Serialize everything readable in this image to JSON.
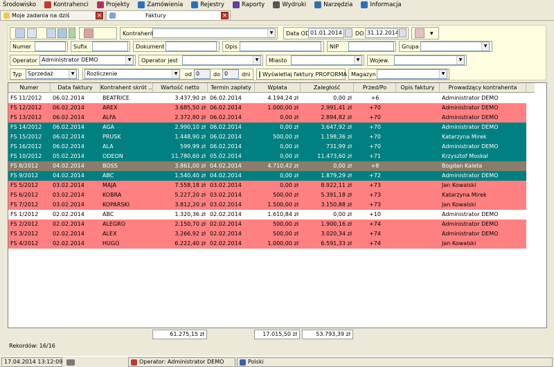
{
  "menu": [
    {
      "label": "Środowisko",
      "icon": "none"
    },
    {
      "label": "Kontrahenci",
      "icon": "person-icon",
      "color": "#c0392b"
    },
    {
      "label": "Projekty",
      "icon": "projects-icon",
      "color": "#b03060"
    },
    {
      "label": "Zamówienia",
      "icon": "orders-icon",
      "color": "#2a70c0"
    },
    {
      "label": "Rejestry",
      "icon": "register-icon",
      "color": "#2a70c0"
    },
    {
      "label": "Raporty",
      "icon": "reports-icon",
      "color": "#6040a0"
    },
    {
      "label": "Wydruki",
      "icon": "printer-icon",
      "color": "#555555"
    },
    {
      "label": "Narzędzia",
      "icon": "tools-icon",
      "color": "#3070b0"
    },
    {
      "label": "Informacja",
      "icon": "info-icon",
      "color": "#2a70c0"
    }
  ],
  "tabs": [
    {
      "label": "Moje zadania na dziś",
      "close": "✕"
    },
    {
      "label": "Faktury",
      "close": "✕"
    }
  ],
  "filters": {
    "kontrahent_label": "Kontrahent",
    "kontrahent_value": "",
    "date_from_label": "Data OD",
    "date_from": "01.01.2014",
    "date_to_label": "DO",
    "date_to": "31.12.2014",
    "numer_label": "Numer",
    "sufix_label": "Sufix",
    "dokument_label": "Dokument",
    "opis_label": "Opis",
    "nip_label": "NIP",
    "grupa_label": "Grupa",
    "operator_label": "Operator",
    "operator_value": "Administrator DEMO",
    "operator_jest_label": "Operator jest",
    "miasto_label": "Miasto",
    "wojew_label": "Wojew.",
    "typ_label": "Typ",
    "typ_value": "Sprzedaż",
    "rozliczenie_value": "Rozliczenie",
    "od_label": "od",
    "od_value": "0",
    "do_label": "do",
    "do_value": "0",
    "dni_label": "dni",
    "proforma_label": "Wyświetlaj faktury PROFORMA",
    "magazyn_label": "Magazyn"
  },
  "columns": [
    "Numer",
    "Data faktury",
    "Kontrahent skrót ...",
    "Wartość netto",
    "Termin zapłaty",
    "Wpłata",
    "Zaległość",
    "Przed/Po",
    "Opis faktury",
    "Prowadzący kontrahenta"
  ],
  "rows": [
    {
      "numer": "FS 11/2012",
      "data": "06.02.2014",
      "kontrahent": "BEATRICE",
      "netto": "3.437,90 zł",
      "termin": "06.02.2014",
      "wplata": "4.194,24 zł",
      "zaleglosc": "0,00 zł",
      "przedpo": "+6",
      "opis": "",
      "prowadzacy": "Administrator DEMO",
      "bg": "#ffffff",
      "fg": "#000000"
    },
    {
      "numer": "FS 12/2012",
      "data": "06.02.2014",
      "kontrahent": "AREX",
      "netto": "3.685,50 zł",
      "termin": "06.02.2014",
      "wplata": "1.000,00 zł",
      "zaleglosc": "2.991,41 zł",
      "przedpo": "+70",
      "opis": "",
      "prowadzacy": "Administrator DEMO",
      "bg": "#ff8080",
      "fg": "#000000"
    },
    {
      "numer": "FS 13/2012",
      "data": "06.02.2014",
      "kontrahent": "ALFA",
      "netto": "2.372,80 zł",
      "termin": "06.02.2014",
      "wplata": "0,00 zł",
      "zaleglosc": "2.894,82 zł",
      "przedpo": "+70",
      "opis": "",
      "prowadzacy": "Administrator DEMO",
      "bg": "#ff8080",
      "fg": "#000000"
    },
    {
      "numer": "FS 14/2012",
      "data": "06.02.2014",
      "kontrahent": "AGA",
      "netto": "2.990,10 zł",
      "termin": "06.02.2014",
      "wplata": "0,00 zł",
      "zaleglosc": "3.647,92 zł",
      "przedpo": "+70",
      "opis": "",
      "prowadzacy": "Administrator DEMO",
      "bg": "#008080",
      "fg": "#ffffff"
    },
    {
      "numer": "FS 15/2012",
      "data": "06.02.2014",
      "kontrahent": "PRUSK",
      "netto": "1.448,90 zł",
      "termin": "06.02.2014",
      "wplata": "500,00 zł",
      "zaleglosc": "1.198,36 zł",
      "przedpo": "+70",
      "opis": "",
      "prowadzacy": "Katarzyna Mirek",
      "bg": "#008080",
      "fg": "#ffffff"
    },
    {
      "numer": "FS 16/2012",
      "data": "06.02.2014",
      "kontrahent": "ALA",
      "netto": "599,99 zł",
      "termin": "06.02.2014",
      "wplata": "0,00 zł",
      "zaleglosc": "731,99 zł",
      "przedpo": "+70",
      "opis": "",
      "prowadzacy": "Administrator DEMO",
      "bg": "#008080",
      "fg": "#ffffff"
    },
    {
      "numer": "FS 10/2012",
      "data": "05.02.2014",
      "kontrahent": "ODEON",
      "netto": "11.780,60 zł",
      "termin": "05.02.2014",
      "wplata": "0,00 zł",
      "zaleglosc": "11.473,60 zł",
      "przedpo": "+71",
      "opis": "",
      "prowadzacy": "Krzysztof Moskal",
      "bg": "#008080",
      "fg": "#ffffff"
    },
    {
      "numer": "FS 8/2012",
      "data": "04.02.2014",
      "kontrahent": "BOSS",
      "netto": "3.861,00 zł",
      "termin": "04.02.2014",
      "wplata": "4.710,42 zł",
      "zaleglosc": "0,00 zł",
      "przedpo": "+8",
      "opis": "",
      "prowadzacy": "Bogdan Kaleta",
      "bg": "#8b7d6b",
      "fg": "#ffffff"
    },
    {
      "numer": "FS 9/2012",
      "data": "04.02.2014",
      "kontrahent": "ABC",
      "netto": "1.540,40 zł",
      "termin": "04.02.2014",
      "wplata": "0,00 zł",
      "zaleglosc": "1.879,29 zł",
      "przedpo": "+72",
      "opis": "",
      "prowadzacy": "Administrator DEMO",
      "bg": "#008080",
      "fg": "#ffffff"
    },
    {
      "numer": "FS 5/2012",
      "data": "03.02.2014",
      "kontrahent": "MAJA",
      "netto": "7.558,18 zł",
      "termin": "03.02.2014",
      "wplata": "0,00 zł",
      "zaleglosc": "8.922,11 zł",
      "przedpo": "+73",
      "opis": "",
      "prowadzacy": "Jan Kowalski",
      "bg": "#ff8080",
      "fg": "#000000"
    },
    {
      "numer": "FS 6/2012",
      "data": "03.02.2014",
      "kontrahent": "KOBRA",
      "netto": "5.227,20 zł",
      "termin": "03.02.2014",
      "wplata": "500,00 zł",
      "zaleglosc": "5.391,18 zł",
      "przedpo": "+73",
      "opis": "",
      "prowadzacy": "Katarzyna Mirek",
      "bg": "#ff8080",
      "fg": "#000000"
    },
    {
      "numer": "FS 7/2012",
      "data": "03.02.2014",
      "kontrahent": "KOPARSKI",
      "netto": "3.812,20 zł",
      "termin": "03.02.2014",
      "wplata": "1.500,00 zł",
      "zaleglosc": "3.150,88 zł",
      "przedpo": "+73",
      "opis": "",
      "prowadzacy": "Jan Kowalski",
      "bg": "#ff8080",
      "fg": "#000000"
    },
    {
      "numer": "FS 1/2012",
      "data": "02.02.2014",
      "kontrahent": "ABC",
      "netto": "1.320,36 zł",
      "termin": "02.02.2014",
      "wplata": "1.610,84 zł",
      "zaleglosc": "0,00 zł",
      "przedpo": "+10",
      "opis": "",
      "prowadzacy": "Administrator DEMO",
      "bg": "#ffffff",
      "fg": "#000000"
    },
    {
      "numer": "FS 2/2012",
      "data": "02.02.2014",
      "kontrahent": "ALEGRO",
      "netto": "2.150,70 zł",
      "termin": "02.02.2014",
      "wplata": "500,00 zł",
      "zaleglosc": "1.900,16 zł",
      "przedpo": "+74",
      "opis": "",
      "prowadzacy": "Administrator DEMO",
      "bg": "#ff8080",
      "fg": "#000000"
    },
    {
      "numer": "FS 3/2012",
      "data": "02.02.2014",
      "kontrahent": "ALEX",
      "netto": "3.266,92 zł",
      "termin": "02.02.2014",
      "wplata": "500,00 zł",
      "zaleglosc": "3.020,34 zł",
      "przedpo": "+74",
      "opis": "",
      "prowadzacy": "Administrator DEMO",
      "bg": "#ff8080",
      "fg": "#000000"
    },
    {
      "numer": "FS 4/2012",
      "data": "02.02.2014",
      "kontrahent": "HUGO",
      "netto": "6.222,40 zł",
      "termin": "02.02.2014",
      "wplata": "1.000,00 zł",
      "zaleglosc": "6.591,33 zł",
      "przedpo": "+74",
      "opis": "",
      "prowadzacy": "Jan Kowalski",
      "bg": "#ff8080",
      "fg": "#000000"
    }
  ],
  "totals": {
    "netto": "61.275,15 zł",
    "wplata": "17.015,50 zł",
    "zaleglosc": "53.793,39 zł"
  },
  "records": "Rekordów: 16/16",
  "status": {
    "datetime": "17.04.2014 13:12:09",
    "operator": "Operator: Administrator DEMO",
    "language": "Polski"
  }
}
